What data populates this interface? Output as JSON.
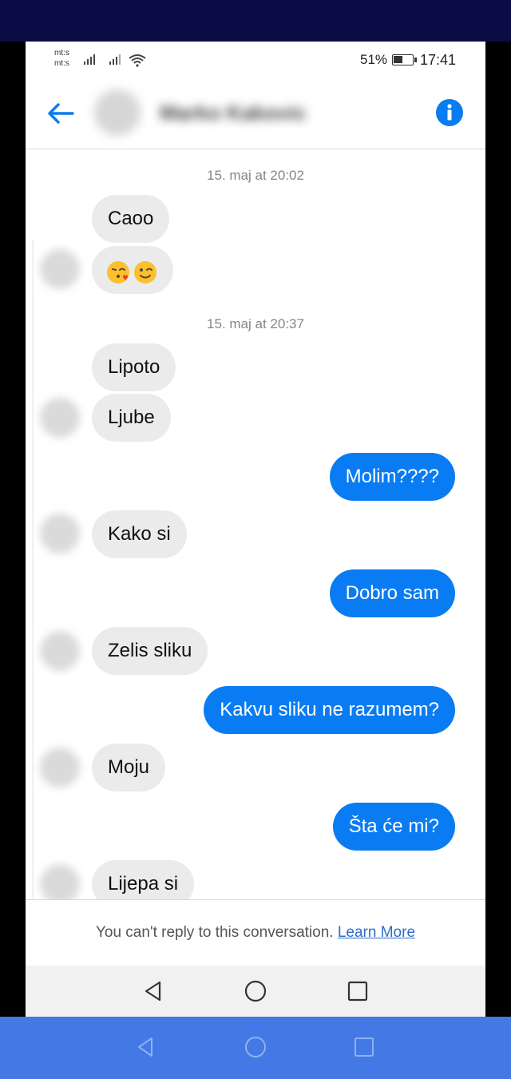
{
  "status_bar": {
    "carrier_1": "mt:s",
    "carrier_2": "mt:s",
    "battery_percent": "51%",
    "battery_level": 0.5,
    "time": "17:41"
  },
  "header": {
    "contact_name": "Marko Kakovic",
    "back_icon": "arrow-left-icon",
    "info_icon": "info-circle-icon"
  },
  "thread": {
    "timestamps": [
      "15. maj at 20:02",
      "15. maj at 20:37"
    ],
    "messages": [
      {
        "sender": "them",
        "text": "Caoo"
      },
      {
        "sender": "them",
        "text": "😘😉"
      },
      {
        "sender": "them",
        "text": "Lipoto"
      },
      {
        "sender": "them",
        "text": "Ljube"
      },
      {
        "sender": "me",
        "text": "Molim????"
      },
      {
        "sender": "them",
        "text": "Kako si"
      },
      {
        "sender": "me",
        "text": "Dobro sam"
      },
      {
        "sender": "them",
        "text": "Zelis sliku"
      },
      {
        "sender": "me",
        "text": "Kakvu sliku ne razumem?"
      },
      {
        "sender": "them",
        "text": "Moju"
      },
      {
        "sender": "me",
        "text": "Šta će mi?"
      },
      {
        "sender": "them",
        "text": "Lijepa si"
      }
    ]
  },
  "footer": {
    "notice": "You can't reply to this conversation.",
    "learn_more": "Learn More"
  },
  "colors": {
    "accent": "#0a7cf3",
    "incoming_bubble": "#ebebeb",
    "top_band": "#0b0c45",
    "bottom_band": "#4478e4"
  },
  "nav": {
    "back_icon": "triangle-back-icon",
    "home_icon": "circle-home-icon",
    "recents_icon": "square-recents-icon"
  }
}
